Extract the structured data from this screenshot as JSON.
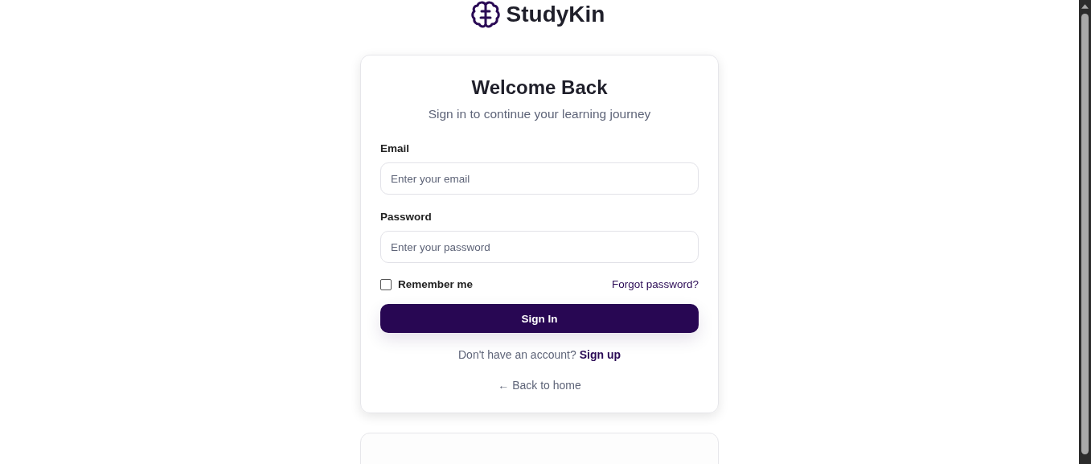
{
  "brand": {
    "name": "StudyKin"
  },
  "card": {
    "title": "Welcome Back",
    "subtitle": "Sign in to continue your learning journey"
  },
  "fields": [
    {
      "label": "Email",
      "placeholder": "Enter your email"
    },
    {
      "label": "Password",
      "placeholder": "Enter your password"
    }
  ],
  "remember": {
    "label": "Remember me",
    "checked": false
  },
  "forgot_link": "Forgot password?",
  "submit_button": "Sign In",
  "signup": {
    "text": "Don't have an account?",
    "link": "Sign up"
  },
  "back_link": "← Back to home"
}
